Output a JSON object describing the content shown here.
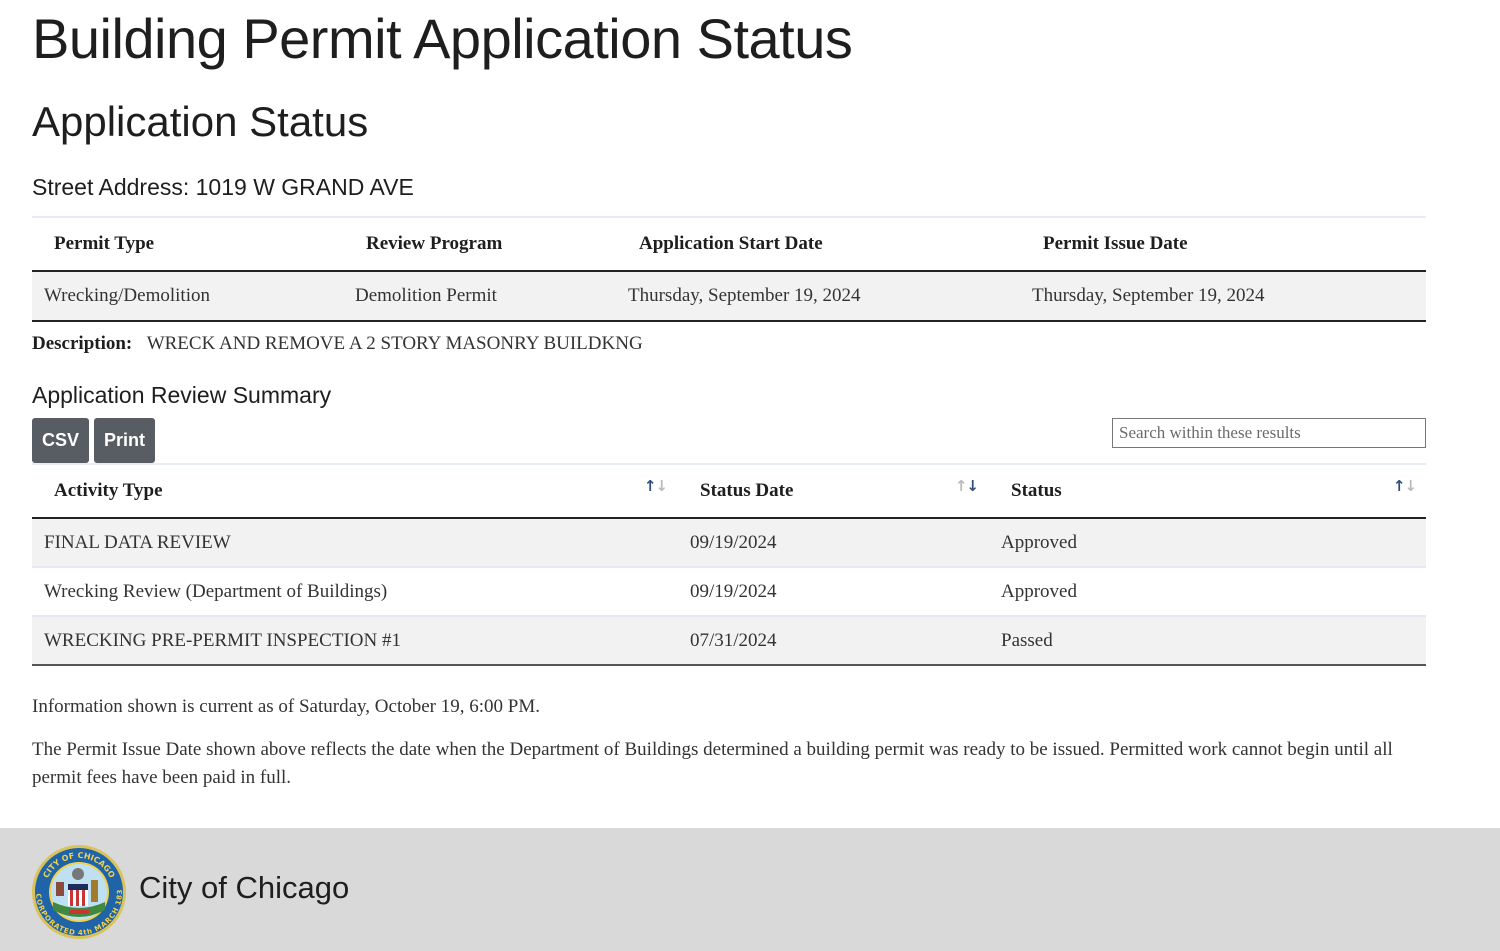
{
  "page": {
    "title": "Building Permit Application Status",
    "section_title": "Application Status",
    "street_address_label": "Street Address:",
    "street_address": "1019 W GRAND AVE"
  },
  "permit": {
    "columns": [
      "Permit Type",
      "Review Program",
      "Application Start Date",
      "Permit Issue Date"
    ],
    "row": {
      "permit_type": "Wrecking/Demolition",
      "review_program": "Demolition Permit",
      "application_start_date": "Thursday, September 19, 2024",
      "permit_issue_date": "Thursday, September 19, 2024"
    },
    "description_label": "Description:",
    "description": "WRECK AND REMOVE A 2 STORY MASONRY BUILDKNG"
  },
  "review_summary": {
    "title": "Application Review Summary",
    "buttons": {
      "csv": "CSV",
      "print": "Print"
    },
    "search_placeholder": "Search within these results",
    "columns": [
      {
        "label": "Activity Type",
        "sort_icon": "sort-asc-icon"
      },
      {
        "label": "Status Date",
        "sort_icon": "sort-desc-icon"
      },
      {
        "label": "Status",
        "sort_icon": "sort-asc-icon"
      }
    ],
    "rows": [
      {
        "activity_type": "FINAL DATA REVIEW",
        "status_date": "09/19/2024",
        "status": "Approved"
      },
      {
        "activity_type": "Wrecking Review (Department of Buildings)",
        "status_date": "09/19/2024",
        "status": "Approved"
      },
      {
        "activity_type": "WRECKING PRE-PERMIT INSPECTION #1",
        "status_date": "07/31/2024",
        "status": "Passed"
      }
    ]
  },
  "info": {
    "current_as_of": "Information shown is current as of Saturday, October 19, 6:00 PM.",
    "issue_date_note": "The Permit Issue Date shown above reflects the date when the Department of Buildings determined a building permit was ready to be issued. Permitted work cannot begin until all permit fees have been paid in full."
  },
  "footer": {
    "name": "City of Chicago",
    "seal_icon": "city-seal-icon",
    "seal_text_top": "CITY OF CHICAGO",
    "seal_text_bottom": "INCORPORATED 4th MARCH 1837"
  },
  "colors": {
    "button_bg": "#585c63",
    "footer_bg": "#d9d9d9",
    "row_stripe": "#f2f2f2",
    "sort_active": "#2f4f7a"
  }
}
